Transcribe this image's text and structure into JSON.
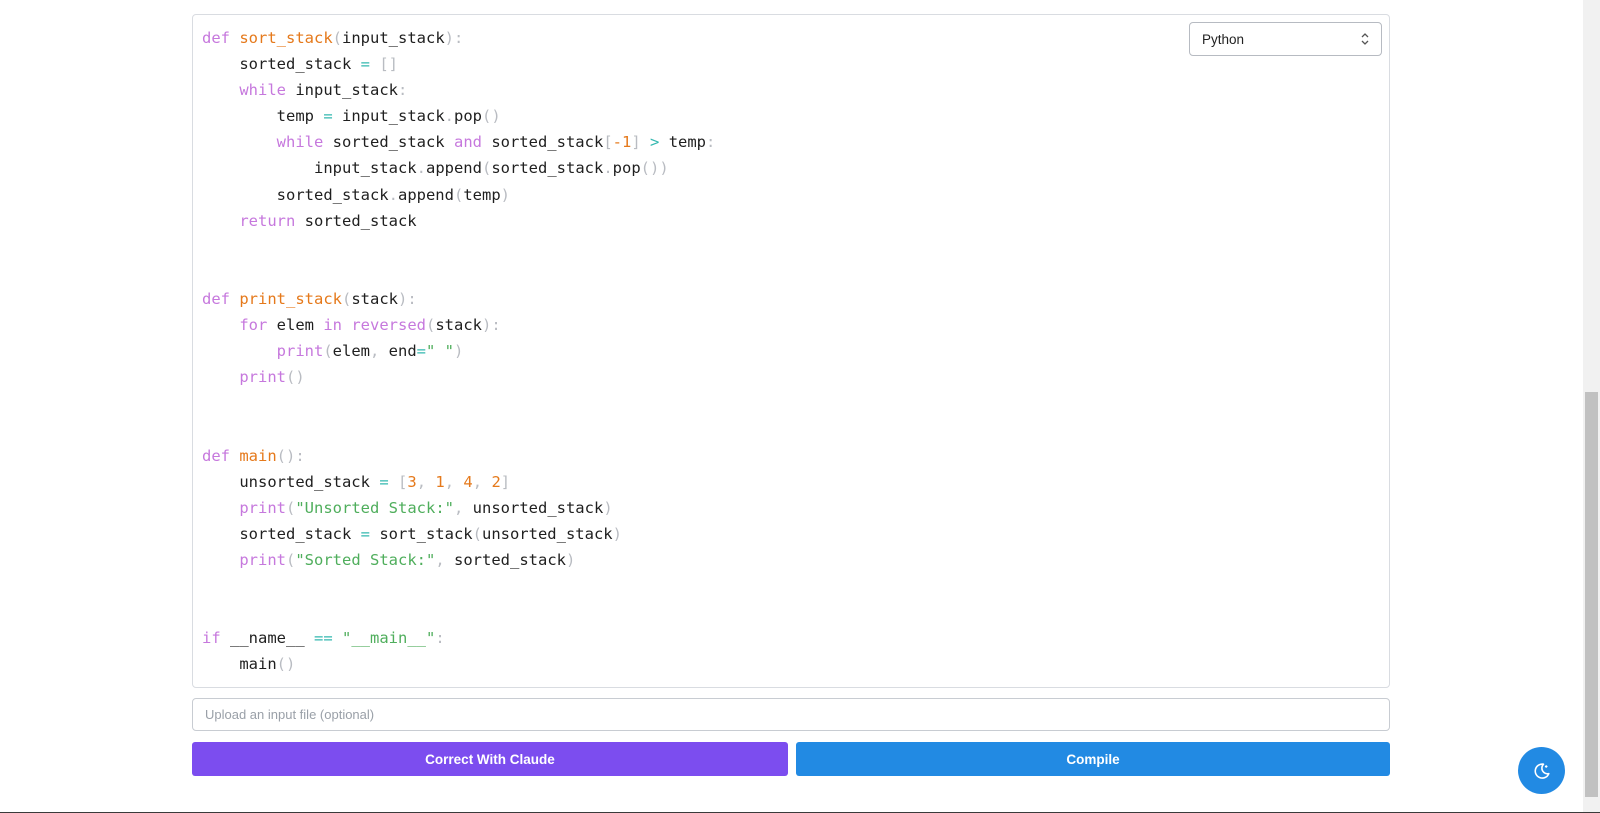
{
  "editor": {
    "language": "Python",
    "code_lines": [
      [
        [
          "kw",
          "def"
        ],
        [
          "plain",
          " "
        ],
        [
          "fn",
          "sort_stack"
        ],
        [
          "punc",
          "("
        ],
        [
          "var",
          "input_stack"
        ],
        [
          "punc",
          "):"
        ]
      ],
      [
        [
          "plain",
          "    sorted_stack "
        ],
        [
          "op",
          "="
        ],
        [
          "plain",
          " "
        ],
        [
          "punc",
          "[]"
        ]
      ],
      [
        [
          "plain",
          "    "
        ],
        [
          "kw",
          "while"
        ],
        [
          "plain",
          " input_stack"
        ],
        [
          "punc",
          ":"
        ]
      ],
      [
        [
          "plain",
          "        temp "
        ],
        [
          "op",
          "="
        ],
        [
          "plain",
          " input_stack"
        ],
        [
          "punc",
          "."
        ],
        [
          "plain",
          "pop"
        ],
        [
          "punc",
          "()"
        ]
      ],
      [
        [
          "plain",
          "        "
        ],
        [
          "kw",
          "while"
        ],
        [
          "plain",
          " sorted_stack "
        ],
        [
          "kw",
          "and"
        ],
        [
          "plain",
          " sorted_stack"
        ],
        [
          "punc",
          "["
        ],
        [
          "num",
          "-1"
        ],
        [
          "punc",
          "]"
        ],
        [
          "plain",
          " "
        ],
        [
          "op",
          ">"
        ],
        [
          "plain",
          " temp"
        ],
        [
          "punc",
          ":"
        ]
      ],
      [
        [
          "plain",
          "            input_stack"
        ],
        [
          "punc",
          "."
        ],
        [
          "plain",
          "append"
        ],
        [
          "punc",
          "("
        ],
        [
          "plain",
          "sorted_stack"
        ],
        [
          "punc",
          "."
        ],
        [
          "plain",
          "pop"
        ],
        [
          "punc",
          "())"
        ]
      ],
      [
        [
          "plain",
          "        sorted_stack"
        ],
        [
          "punc",
          "."
        ],
        [
          "plain",
          "append"
        ],
        [
          "punc",
          "("
        ],
        [
          "plain",
          "temp"
        ],
        [
          "punc",
          ")"
        ]
      ],
      [
        [
          "plain",
          "    "
        ],
        [
          "kw",
          "return"
        ],
        [
          "plain",
          " sorted_stack"
        ]
      ],
      [],
      [],
      [
        [
          "kw",
          "def"
        ],
        [
          "plain",
          " "
        ],
        [
          "fn",
          "print_stack"
        ],
        [
          "punc",
          "("
        ],
        [
          "var",
          "stack"
        ],
        [
          "punc",
          "):"
        ]
      ],
      [
        [
          "plain",
          "    "
        ],
        [
          "kw",
          "for"
        ],
        [
          "plain",
          " elem "
        ],
        [
          "kw",
          "in"
        ],
        [
          "plain",
          " "
        ],
        [
          "builtin",
          "reversed"
        ],
        [
          "punc",
          "("
        ],
        [
          "plain",
          "stack"
        ],
        [
          "punc",
          "):"
        ]
      ],
      [
        [
          "plain",
          "        "
        ],
        [
          "builtin",
          "print"
        ],
        [
          "punc",
          "("
        ],
        [
          "plain",
          "elem"
        ],
        [
          "punc",
          ","
        ],
        [
          "plain",
          " end"
        ],
        [
          "op",
          "="
        ],
        [
          "str",
          "\" \""
        ],
        [
          "punc",
          ")"
        ]
      ],
      [
        [
          "plain",
          "    "
        ],
        [
          "builtin",
          "print"
        ],
        [
          "punc",
          "()"
        ]
      ],
      [],
      [],
      [
        [
          "kw",
          "def"
        ],
        [
          "plain",
          " "
        ],
        [
          "fn",
          "main"
        ],
        [
          "punc",
          "():"
        ]
      ],
      [
        [
          "plain",
          "    unsorted_stack "
        ],
        [
          "op",
          "="
        ],
        [
          "plain",
          " "
        ],
        [
          "punc",
          "["
        ],
        [
          "num",
          "3"
        ],
        [
          "punc",
          ","
        ],
        [
          "plain",
          " "
        ],
        [
          "num",
          "1"
        ],
        [
          "punc",
          ","
        ],
        [
          "plain",
          " "
        ],
        [
          "num",
          "4"
        ],
        [
          "punc",
          ","
        ],
        [
          "plain",
          " "
        ],
        [
          "num",
          "2"
        ],
        [
          "punc",
          "]"
        ]
      ],
      [
        [
          "plain",
          "    "
        ],
        [
          "builtin",
          "print"
        ],
        [
          "punc",
          "("
        ],
        [
          "str",
          "\"Unsorted Stack:\""
        ],
        [
          "punc",
          ","
        ],
        [
          "plain",
          " unsorted_stack"
        ],
        [
          "punc",
          ")"
        ]
      ],
      [
        [
          "plain",
          "    sorted_stack "
        ],
        [
          "op",
          "="
        ],
        [
          "plain",
          " sort_stack"
        ],
        [
          "punc",
          "("
        ],
        [
          "plain",
          "unsorted_stack"
        ],
        [
          "punc",
          ")"
        ]
      ],
      [
        [
          "plain",
          "    "
        ],
        [
          "builtin",
          "print"
        ],
        [
          "punc",
          "("
        ],
        [
          "str",
          "\"Sorted Stack:\""
        ],
        [
          "punc",
          ","
        ],
        [
          "plain",
          " sorted_stack"
        ],
        [
          "punc",
          ")"
        ]
      ],
      [],
      [],
      [
        [
          "kw",
          "if"
        ],
        [
          "plain",
          " __name__ "
        ],
        [
          "op",
          "=="
        ],
        [
          "plain",
          " "
        ],
        [
          "str",
          "\"__main__\""
        ],
        [
          "punc",
          ":"
        ]
      ],
      [
        [
          "plain",
          "    main"
        ],
        [
          "punc",
          "()"
        ]
      ]
    ]
  },
  "upload": {
    "placeholder": "Upload an input file (optional)"
  },
  "buttons": {
    "correct_label": "Correct With Claude",
    "compile_label": "Compile"
  },
  "icons": {
    "select_chevron": "chevron-up-down-icon",
    "theme_toggle": "moon-icon"
  },
  "colors": {
    "correct_button": "#7c4def",
    "compile_button": "#228ae3",
    "theme_toggle": "#228ae3"
  }
}
